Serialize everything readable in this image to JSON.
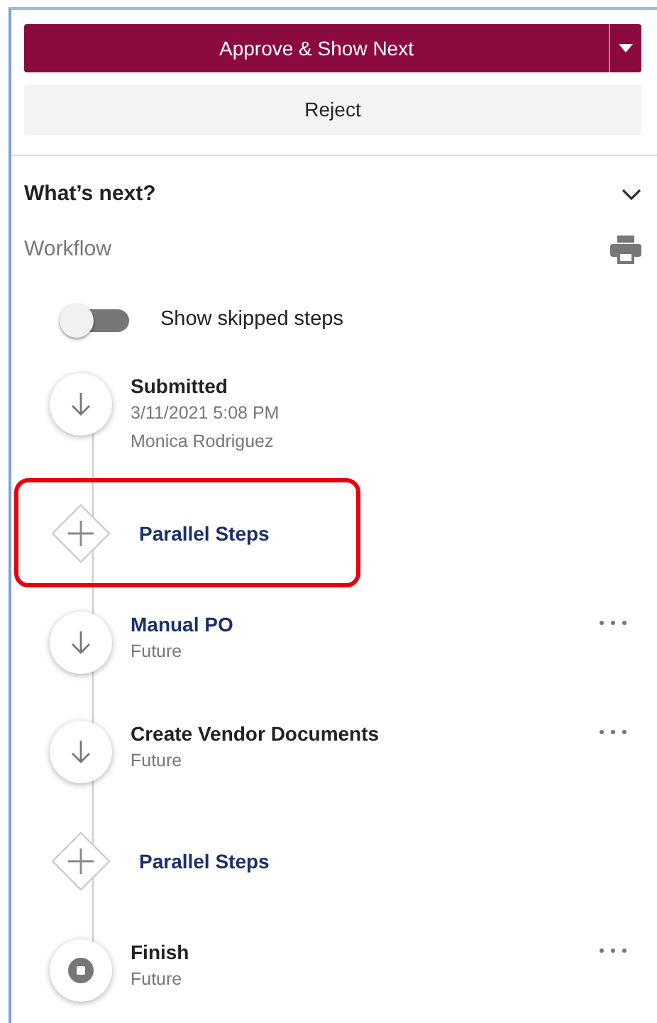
{
  "actions": {
    "primary": "Approve & Show Next",
    "secondary": "Reject"
  },
  "section": {
    "title": "What’s next?",
    "expanded": true
  },
  "workflow": {
    "label": "Workflow"
  },
  "toggle": {
    "label": "Show skipped steps",
    "on": false
  },
  "steps": [
    {
      "kind": "step",
      "title": "Submitted",
      "link": false,
      "lines": [
        "3/11/2021 5:08 PM",
        "Monica Rodriguez"
      ],
      "menu": false,
      "highlighted": false
    },
    {
      "kind": "parallel",
      "title": "Parallel Steps",
      "link": true,
      "menu": false,
      "highlighted": true
    },
    {
      "kind": "step",
      "title": "Manual PO",
      "link": true,
      "lines": [
        "Future"
      ],
      "menu": true,
      "highlighted": false
    },
    {
      "kind": "step",
      "title": "Create Vendor Documents",
      "link": false,
      "lines": [
        "Future"
      ],
      "menu": true,
      "highlighted": false
    },
    {
      "kind": "parallel",
      "title": "Parallel Steps",
      "link": true,
      "menu": false,
      "highlighted": false
    },
    {
      "kind": "finish",
      "title": "Finish",
      "link": false,
      "lines": [
        "Future"
      ],
      "menu": true,
      "highlighted": false
    }
  ]
}
